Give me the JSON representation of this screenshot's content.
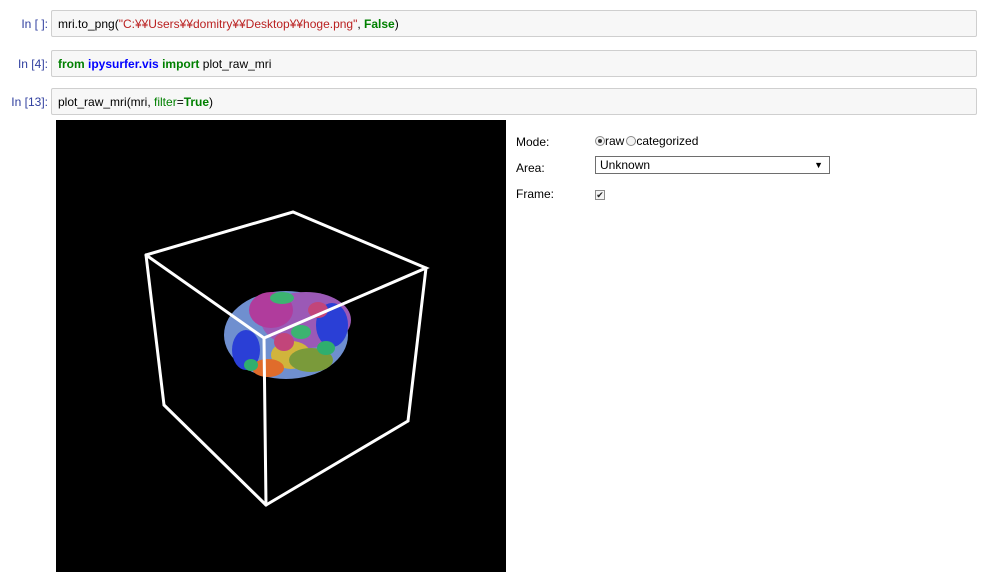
{
  "cells": [
    {
      "prompt": "In [ ]:",
      "code": {
        "fn": "mri.to_png(",
        "str": "\"C:¥¥Users¥¥domitry¥¥Desktop¥¥hoge.png\"",
        "sep": ", ",
        "bool": "False",
        "close": ")"
      }
    },
    {
      "prompt": "In [4]:",
      "code": {
        "from": "from",
        "module": "ipysurfer.vis",
        "import": "import",
        "name": "plot_raw_mri"
      }
    },
    {
      "prompt": "In [13]:",
      "code": {
        "fn": "plot_raw_mri(mri, ",
        "kwarg": "filter",
        "eq": "=",
        "bool": "True",
        "close": ")"
      }
    }
  ],
  "widget": {
    "mode_label": "Mode:",
    "mode_options": [
      "raw",
      "categorized"
    ],
    "mode_selected": "raw",
    "area_label": "Area:",
    "area_value": "Unknown",
    "frame_label": "Frame:",
    "frame_checked": true,
    "checkmark": "✔"
  },
  "viewer": {
    "background": "#000000",
    "frame_color": "#ffffff",
    "brain_colors": [
      "#9b59b6",
      "#b03c9c",
      "#2a3fd6",
      "#3cb371",
      "#e06c2b",
      "#7a9a3a",
      "#c2457a",
      "#6f8fcf",
      "#d1b43c",
      "#2fae6e"
    ]
  },
  "icons": {
    "dropdown": "▼"
  }
}
